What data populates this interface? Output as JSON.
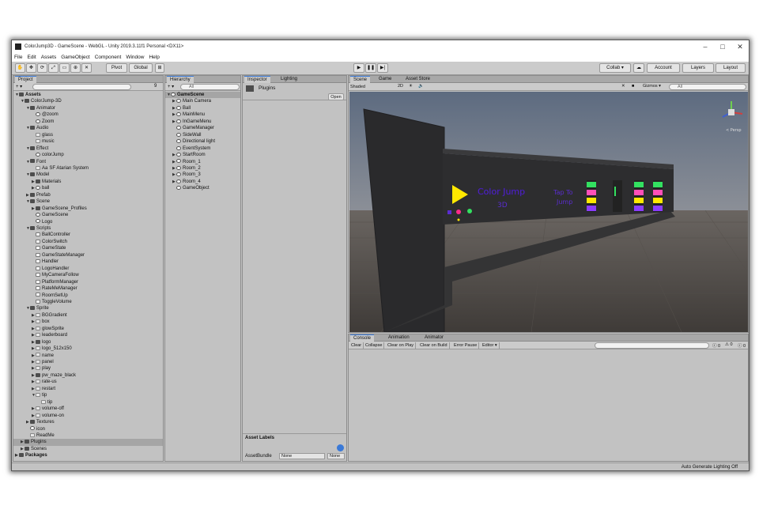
{
  "title": "ColorJump3D - GameScene - WebGL - Unity 2019.3.11f1 Personal <DX11>",
  "window_controls": {
    "minimize": "–",
    "maximize": "□",
    "close": "✕"
  },
  "menu": [
    "File",
    "Edit",
    "Assets",
    "GameObject",
    "Component",
    "Window",
    "Help"
  ],
  "toolbar": {
    "pivot": "Pivot",
    "global": "Global",
    "play": "▶",
    "pause": "❚❚",
    "step": "▶|",
    "collab": "Collab ▾",
    "account": "Account",
    "layers": "Layers",
    "layout": "Layout"
  },
  "project": {
    "tab": "Project",
    "add": "+ ▾",
    "badge": "9",
    "items": [
      {
        "label": "Assets",
        "depth": 0,
        "icon": "folder",
        "bold": true,
        "arrow": "▼"
      },
      {
        "label": "ColorJump-3D",
        "depth": 1,
        "icon": "folder",
        "arrow": "▼"
      },
      {
        "label": "Animator",
        "depth": 2,
        "icon": "folder",
        "arrow": "▼"
      },
      {
        "label": "@zoom",
        "depth": 3,
        "icon": "cube",
        "arrow": ""
      },
      {
        "label": "Zoom",
        "depth": 3,
        "icon": "cube",
        "arrow": ""
      },
      {
        "label": "Audio",
        "depth": 2,
        "icon": "folder",
        "arrow": "▼"
      },
      {
        "label": "glass",
        "depth": 3,
        "icon": "img",
        "arrow": ""
      },
      {
        "label": "music",
        "depth": 3,
        "icon": "img",
        "arrow": ""
      },
      {
        "label": "Effect",
        "depth": 2,
        "icon": "folder",
        "arrow": "▼"
      },
      {
        "label": "colorJump",
        "depth": 3,
        "icon": "cube",
        "arrow": ""
      },
      {
        "label": "Font",
        "depth": 2,
        "icon": "folder",
        "arrow": "▼"
      },
      {
        "label": "SF Atarian System",
        "depth": 3,
        "icon": "img",
        "arrow": "",
        "prefix": "Aa"
      },
      {
        "label": "Model",
        "depth": 2,
        "icon": "folder",
        "arrow": "▼"
      },
      {
        "label": "Materials",
        "depth": 3,
        "icon": "folder",
        "arrow": "▶"
      },
      {
        "label": "ball",
        "depth": 3,
        "icon": "cube",
        "arrow": "▶"
      },
      {
        "label": "Prefab",
        "depth": 2,
        "icon": "folder",
        "arrow": "▶"
      },
      {
        "label": "Scene",
        "depth": 2,
        "icon": "folder",
        "arrow": "▼"
      },
      {
        "label": "GameScene_Profiles",
        "depth": 3,
        "icon": "folder",
        "arrow": "▶"
      },
      {
        "label": "GameScene",
        "depth": 3,
        "icon": "cube",
        "arrow": ""
      },
      {
        "label": "Logo",
        "depth": 3,
        "icon": "cube",
        "arrow": ""
      },
      {
        "label": "Scripts",
        "depth": 2,
        "icon": "folder",
        "arrow": "▼"
      },
      {
        "label": "BallController",
        "depth": 3,
        "icon": "script",
        "arrow": ""
      },
      {
        "label": "ColorSwitch",
        "depth": 3,
        "icon": "script",
        "arrow": ""
      },
      {
        "label": "GameState",
        "depth": 3,
        "icon": "script",
        "arrow": ""
      },
      {
        "label": "GameStateManager",
        "depth": 3,
        "icon": "script",
        "arrow": ""
      },
      {
        "label": "Handler",
        "depth": 3,
        "icon": "script",
        "arrow": ""
      },
      {
        "label": "LogoHandler",
        "depth": 3,
        "icon": "script",
        "arrow": ""
      },
      {
        "label": "MyCameraFollow",
        "depth": 3,
        "icon": "script",
        "arrow": ""
      },
      {
        "label": "PlatformManager",
        "depth": 3,
        "icon": "script",
        "arrow": ""
      },
      {
        "label": "RateMeManager",
        "depth": 3,
        "icon": "script",
        "arrow": ""
      },
      {
        "label": "RoomSetUp",
        "depth": 3,
        "icon": "script",
        "arrow": ""
      },
      {
        "label": "ToggleVolume",
        "depth": 3,
        "icon": "script",
        "arrow": ""
      },
      {
        "label": "Sprite",
        "depth": 2,
        "icon": "folder",
        "arrow": "▼"
      },
      {
        "label": "BGGradient",
        "depth": 3,
        "icon": "img",
        "arrow": "▶"
      },
      {
        "label": "box",
        "depth": 3,
        "icon": "img",
        "arrow": "▶"
      },
      {
        "label": "glowSprite",
        "depth": 3,
        "icon": "img",
        "arrow": "▶"
      },
      {
        "label": "leaderboard",
        "depth": 3,
        "icon": "img",
        "arrow": "▶"
      },
      {
        "label": "logo",
        "depth": 3,
        "icon": "folder",
        "arrow": "▶"
      },
      {
        "label": "logo_512x150",
        "depth": 3,
        "icon": "img",
        "arrow": "▶"
      },
      {
        "label": "name",
        "depth": 3,
        "icon": "img",
        "arrow": "▶"
      },
      {
        "label": "panel",
        "depth": 3,
        "icon": "img",
        "arrow": "▶"
      },
      {
        "label": "play",
        "depth": 3,
        "icon": "img",
        "arrow": "▶"
      },
      {
        "label": "pw_maze_black",
        "depth": 3,
        "icon": "folder",
        "arrow": "▶"
      },
      {
        "label": "rate-us",
        "depth": 3,
        "icon": "img",
        "arrow": "▶"
      },
      {
        "label": "restart",
        "depth": 3,
        "icon": "img",
        "arrow": "▶"
      },
      {
        "label": "tip",
        "depth": 3,
        "icon": "img",
        "arrow": "▼"
      },
      {
        "label": "tip",
        "depth": 4,
        "icon": "img",
        "arrow": ""
      },
      {
        "label": "volume-off",
        "depth": 3,
        "icon": "img",
        "arrow": "▶"
      },
      {
        "label": "volume-on",
        "depth": 3,
        "icon": "img",
        "arrow": "▶"
      },
      {
        "label": "Textures",
        "depth": 2,
        "icon": "folder",
        "arrow": "▶"
      },
      {
        "label": "icon",
        "depth": 2,
        "icon": "cube",
        "arrow": ""
      },
      {
        "label": "ReadMe",
        "depth": 2,
        "icon": "img",
        "arrow": ""
      },
      {
        "label": "Plugins",
        "depth": 1,
        "icon": "folder",
        "arrow": "▶",
        "selected": true
      },
      {
        "label": "Scenes",
        "depth": 1,
        "icon": "folder",
        "arrow": "▶"
      },
      {
        "label": "Packages",
        "depth": 0,
        "icon": "folder",
        "bold": true,
        "arrow": "▶"
      }
    ]
  },
  "hierarchy": {
    "tab": "Hierarchy",
    "add": "+ ▾",
    "search_placeholder": "All",
    "items": [
      {
        "label": "GameScene",
        "depth": 0,
        "arrow": "▼",
        "bold": true,
        "selected": true
      },
      {
        "label": "Main Camera",
        "depth": 1,
        "arrow": "▶"
      },
      {
        "label": "Ball",
        "depth": 1,
        "arrow": "▶"
      },
      {
        "label": "MainMenu",
        "depth": 1,
        "arrow": "▶"
      },
      {
        "label": "InGameMenu",
        "depth": 1,
        "arrow": "▶"
      },
      {
        "label": "GameManager",
        "depth": 1,
        "arrow": ""
      },
      {
        "label": "SideWall",
        "depth": 1,
        "arrow": ""
      },
      {
        "label": "Directional light",
        "depth": 1,
        "arrow": ""
      },
      {
        "label": "EventSystem",
        "depth": 1,
        "arrow": ""
      },
      {
        "label": "StartRoom",
        "depth": 1,
        "arrow": "▶"
      },
      {
        "label": "Room_1",
        "depth": 1,
        "arrow": "▶"
      },
      {
        "label": "Room_2",
        "depth": 1,
        "arrow": "▶"
      },
      {
        "label": "Room_3",
        "depth": 1,
        "arrow": "▶"
      },
      {
        "label": "Room_4",
        "depth": 1,
        "arrow": "▶"
      },
      {
        "label": "GameObject",
        "depth": 1,
        "arrow": ""
      }
    ]
  },
  "inspector": {
    "tabs": [
      "Inspector",
      "Lighting"
    ],
    "asset_name": "Plugins",
    "open_button": "Open",
    "asset_labels": "Asset Labels",
    "asset_bundle_label": "AssetBundle",
    "asset_bundle_value": "None",
    "asset_bundle_variant": "None"
  },
  "scene": {
    "tabs": [
      "Scene",
      "Game",
      "Asset Store"
    ],
    "shading": "Shaded",
    "mode2d": "2D",
    "gizmos": "Gizmos ▾",
    "search_placeholder": "All",
    "persp": "< Persp",
    "title_line1": "Color Jump",
    "title_line2": "3D",
    "tap_line1": "Tap To",
    "tap_line2": "Jump",
    "colors": {
      "yellow": "#ffe800",
      "purple": "#5a2cd0",
      "green": "#33e060",
      "magenta": "#c24fe0",
      "sky": "#5e6a7a",
      "ground": "#4b4744"
    }
  },
  "console": {
    "tabs": [
      "Console",
      "Animation",
      "Animator"
    ],
    "buttons": [
      "Clear",
      "Collapse",
      "Clear on Play",
      "Clear on Build",
      "Error Pause",
      "Editor ▾"
    ],
    "counts": {
      "info": "0",
      "warn": "0",
      "error": "0"
    }
  },
  "status": "Auto Generate Lighting Off"
}
